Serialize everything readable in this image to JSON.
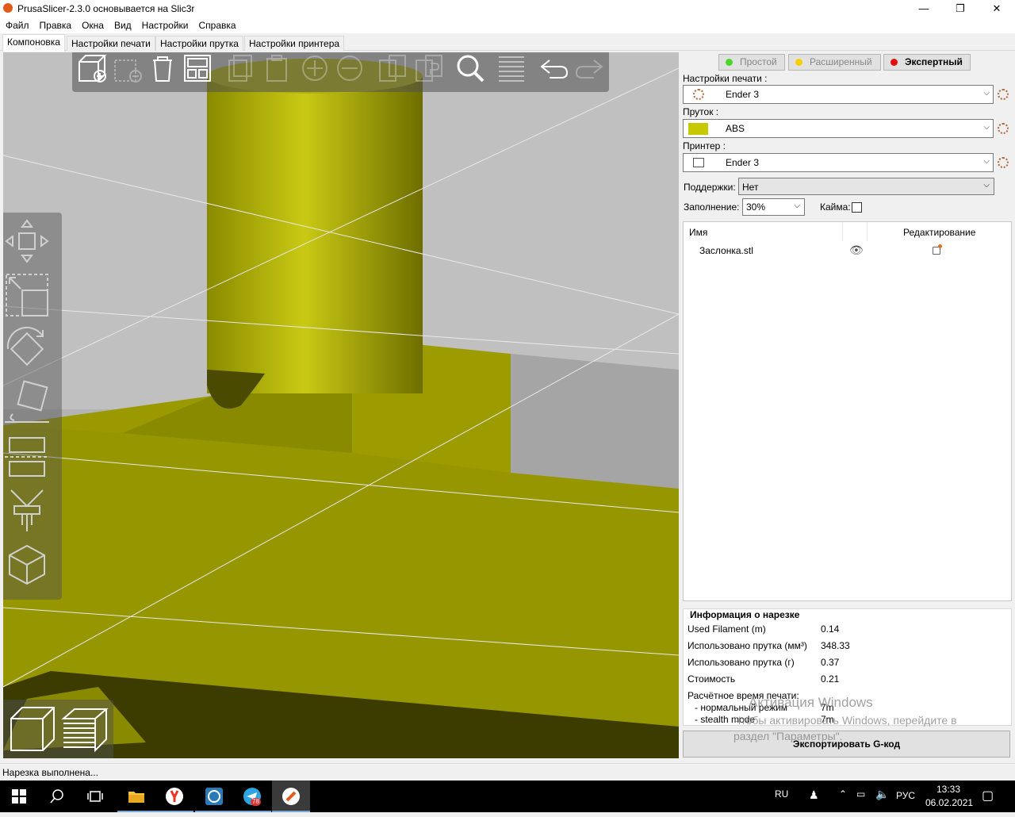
{
  "window": {
    "title": "PrusaSlicer-2.3.0 основывается на Slic3r",
    "minimize": "—",
    "maximize": "❐",
    "close": "✕"
  },
  "menu": [
    "Файл",
    "Правка",
    "Окна",
    "Вид",
    "Настройки",
    "Справка"
  ],
  "tabs": [
    "Компоновка",
    "Настройки печати",
    "Настройки прутка",
    "Настройки принтера"
  ],
  "modes": [
    {
      "label": "Простой",
      "color": "#4cd42c"
    },
    {
      "label": "Расширенный",
      "color": "#f5d000"
    },
    {
      "label": "Экспертный",
      "color": "#e01010"
    }
  ],
  "presets": {
    "print_label": "Настройки печати :",
    "print_value": "Ender 3",
    "filament_label": "Пруток :",
    "filament_value": "ABS",
    "filament_color": "#c8c800",
    "printer_label": "Принтер :",
    "printer_value": "Ender 3",
    "supports_label": "Поддержки:",
    "supports_value": "Нет",
    "infill_label": "Заполнение:",
    "infill_value": "30%",
    "brim_label": "Кайма:"
  },
  "object_list": {
    "col_name": "Имя",
    "col_edit": "Редактирование",
    "items": [
      {
        "name": "Заслонка.stl"
      }
    ]
  },
  "slice_info": {
    "title": "Информация о нарезке",
    "rows": [
      {
        "label": "Used Filament (m)",
        "value": "0.14"
      },
      {
        "label": "Использовано прутка (мм³)",
        "value": "348.33"
      },
      {
        "label": "Использовано прутка (г)",
        "value": "0.37"
      },
      {
        "label": "Стоимость",
        "value": "0.21"
      }
    ],
    "time_label": "Расчётное время печати:",
    "time_normal_label": "- нормальный режим",
    "time_normal_value": "7m",
    "time_stealth_label": "- stealth mode",
    "time_stealth_value": "7m"
  },
  "export_button": "Экспортировать G-код",
  "watermark": {
    "line1": "Активация Windows",
    "line2": "Чтобы активировать Windows, перейдите в",
    "line3": "раздел \"Параметры\"."
  },
  "status": "Нарезка выполнена...",
  "taskbar": {
    "lang": "RU",
    "kbd": "РУС",
    "time": "13:33",
    "date": "06.02.2021",
    "telegram_badge": "78"
  }
}
